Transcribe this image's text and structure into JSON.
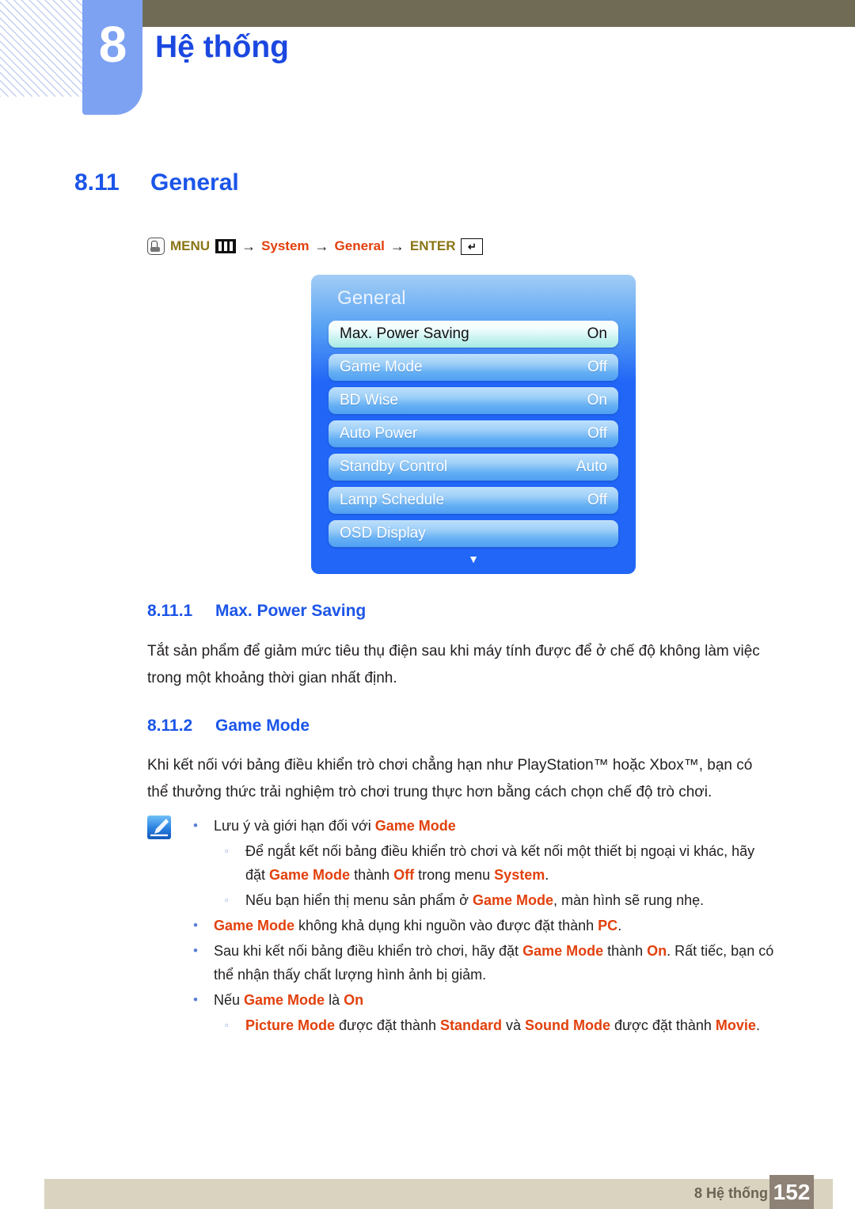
{
  "header": {
    "chapter_number": "8",
    "chapter_title": "Hệ thống"
  },
  "section": {
    "number": "8.11",
    "title": "General"
  },
  "breadcrumb": {
    "menu_label": "MENU",
    "arrow": "→",
    "system_label": "System",
    "general_label": "General",
    "enter_label": "ENTER",
    "enter_glyph": "↵",
    "menu_icon": "hand-press-icon",
    "bars_icon": "menu-bars-icon",
    "colors": {
      "olive": "#8a7516",
      "orange": "#e2400c"
    }
  },
  "osd": {
    "title": "General",
    "items": [
      {
        "label": "Max. Power Saving",
        "value": "On",
        "selected": true
      },
      {
        "label": "Game Mode",
        "value": "Off",
        "selected": false
      },
      {
        "label": "BD Wise",
        "value": "On",
        "selected": false
      },
      {
        "label": "Auto Power",
        "value": "Off",
        "selected": false
      },
      {
        "label": "Standby Control",
        "value": "Auto",
        "selected": false
      },
      {
        "label": "Lamp Schedule",
        "value": "Off",
        "selected": false
      },
      {
        "label": "OSD Display",
        "value": "",
        "selected": false
      }
    ],
    "scroll_caret": "▼",
    "colors": {
      "panel_blue": "#2166f7",
      "selected_cyan": "#a8eae6"
    }
  },
  "subsections": [
    {
      "number": "8.11.1",
      "title": "Max. Power Saving",
      "paragraph": "Tắt sản phẩm để giảm mức tiêu thụ điện sau khi máy tính được để ở chế độ không làm việc trong một khoảng thời gian nhất định."
    },
    {
      "number": "8.11.2",
      "title": "Game Mode",
      "paragraph": "Khi kết nối với bảng điều khiển trò chơi chẳng hạn như PlayStation™ hoặc Xbox™, bạn có thể thưởng thức trải nghiệm trò chơi trung thực hơn bằng cách chọn chế độ trò chơi."
    }
  ],
  "note": {
    "icon": "note-pencil-icon",
    "bullets": [
      {
        "level": 1,
        "bullet": "•",
        "parts": [
          {
            "t": "Lưu ý và giới hạn đối với ",
            "kw": false
          },
          {
            "t": "Game Mode",
            "kw": true
          }
        ]
      },
      {
        "level": 2,
        "bullet": "▫",
        "parts": [
          {
            "t": "Để ngắt kết nối bảng điều khiển trò chơi và kết nối một thiết bị ngoại vi khác, hãy đặt ",
            "kw": false
          },
          {
            "t": "Game Mode",
            "kw": true
          },
          {
            "t": " thành ",
            "kw": false
          },
          {
            "t": "Off",
            "kw": true
          },
          {
            "t": " trong menu ",
            "kw": false
          },
          {
            "t": "System",
            "kw": true
          },
          {
            "t": ".",
            "kw": false
          }
        ]
      },
      {
        "level": 2,
        "bullet": "▫",
        "parts": [
          {
            "t": "Nếu bạn hiển thị menu sản phẩm ở ",
            "kw": false
          },
          {
            "t": "Game Mode",
            "kw": true
          },
          {
            "t": ", màn hình sẽ rung nhẹ.",
            "kw": false
          }
        ]
      },
      {
        "level": 1,
        "bullet": "•",
        "parts": [
          {
            "t": "Game Mode",
            "kw": true
          },
          {
            "t": " không khả dụng khi nguồn vào được đặt thành ",
            "kw": false
          },
          {
            "t": "PC",
            "kw": true
          },
          {
            "t": ".",
            "kw": false
          }
        ]
      },
      {
        "level": 1,
        "bullet": "•",
        "parts": [
          {
            "t": "Sau khi kết nối bảng điều khiển trò chơi, hãy đặt ",
            "kw": false
          },
          {
            "t": "Game Mode",
            "kw": true
          },
          {
            "t": " thành ",
            "kw": false
          },
          {
            "t": "On",
            "kw": true
          },
          {
            "t": ". Rất tiếc, bạn có thể nhận thấy chất lượng hình ảnh bị giảm.",
            "kw": false
          }
        ]
      },
      {
        "level": 1,
        "bullet": "•",
        "parts": [
          {
            "t": "Nếu ",
            "kw": false
          },
          {
            "t": "Game Mode",
            "kw": true
          },
          {
            "t": " là ",
            "kw": false
          },
          {
            "t": "On",
            "kw": true
          }
        ]
      },
      {
        "level": 2,
        "bullet": "▫",
        "parts": [
          {
            "t": "Picture Mode",
            "kw": true
          },
          {
            "t": " được đặt thành ",
            "kw": false
          },
          {
            "t": "Standard",
            "kw": true
          },
          {
            "t": " và ",
            "kw": false
          },
          {
            "t": "Sound Mode",
            "kw": true
          },
          {
            "t": " được đặt thành ",
            "kw": false
          },
          {
            "t": "Movie",
            "kw": true
          },
          {
            "t": ".",
            "kw": false
          }
        ]
      }
    ]
  },
  "footer": {
    "label": "8 Hệ thống",
    "page_number": "152"
  }
}
